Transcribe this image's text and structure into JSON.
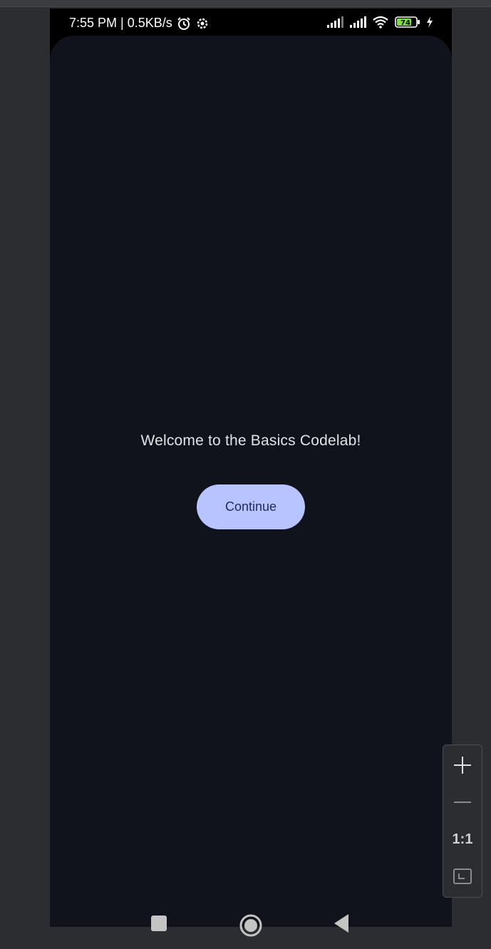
{
  "status_bar": {
    "time_speed": "7:55 PM | 0.5KB/s",
    "battery_level": "74",
    "icons": [
      "alarm-icon",
      "settings-gear-icon",
      "signal-icon",
      "signal-icon",
      "wifi-icon",
      "battery-icon",
      "charging-icon"
    ]
  },
  "app": {
    "welcome_text": "Welcome to the Basics Codelab!",
    "continue_label": "Continue",
    "colors": {
      "background": "#10131b",
      "button": "#b7c4ff",
      "button_text": "#1c2a5c",
      "text": "#e2e2e9"
    }
  },
  "nav_bar": {
    "icons": [
      "recents-square-icon",
      "home-circle-icon",
      "back-triangle-icon"
    ]
  },
  "zoom_controls": {
    "actual_size_label": "1:1",
    "icons": [
      "zoom-in-icon",
      "zoom-out-icon",
      "fit-screen-icon"
    ]
  }
}
